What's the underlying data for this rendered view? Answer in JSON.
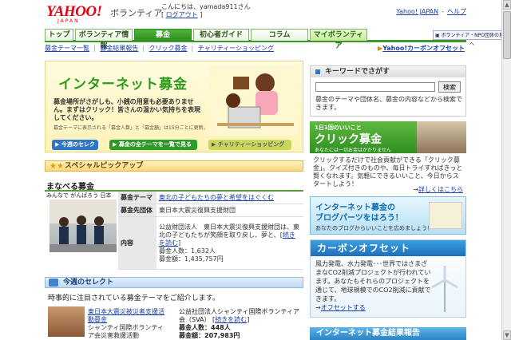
{
  "header": {
    "logo": "YAHOO!",
    "logo_sub": "JAPAN",
    "brand": "ボランティア",
    "greeting": "こんにちは、yamada911さん",
    "logout": "ログアウト",
    "top_links": [
      "Yahoo! JAPAN",
      "ヘルプ"
    ]
  },
  "nav": {
    "tabs": [
      "トップ",
      "ボランティア情報",
      "募金",
      "初心者ガイド",
      "コラム",
      "マイボランティア"
    ],
    "partner": "ボランティア・NPO団体の皆様へ"
  },
  "subnav": {
    "items": [
      "募金テーマ一覧",
      "募金結果報告",
      "クリック募金",
      "チャリティーショッピング"
    ],
    "carbon": "Yahoo!カーボンオフセット"
  },
  "hero": {
    "title": "インターネット募金",
    "desc": "募金場所がさがしも、小銭の用意も必要ありません。まずはクリック！皆さんの温かい気持ちを表現してください。",
    "note": "募金テーマに表示される「募金人数」と「募金額」は15分ごとに更新。",
    "buttons": [
      "今週のセレクト",
      "募金の全テーマを一覧で見る",
      "チャリティーショッピング"
    ]
  },
  "special": {
    "header": "スペシャルピックアップ",
    "title": "まなべる募金",
    "photo_caption": "みんなで がんばろう 日本",
    "rows": [
      {
        "k": "募金テーマ",
        "v": "東北の子どもたちの夢と希望をはぐくむ"
      },
      {
        "k": "募金先団体",
        "v": "東日本大震災復興支援財団"
      },
      {
        "k": "内容",
        "v": "公益財団法人　東日本大震災復興支援財団は、東北の子どもたちが笑顔を取り戻し、夢と、"
      }
    ],
    "more": "続きを読む",
    "people": "募金人数：1,632人",
    "amount": "募金額：1,435,757円"
  },
  "week": {
    "header": "今週のセレクト",
    "desc": "時事的に注目されている募金テーマをご紹介します。",
    "title": "東日本大震災被災者支援活動募金",
    "org": "シャンティ国際ボランティア会災害救援活動",
    "org2": "公益社団法人シャンティ国際ボランティア会（SVA）",
    "more": "続きを読む",
    "people": "募金人数：448人",
    "amount": "募金額：207,983円"
  },
  "keyword": {
    "header": "キーワードでさがす",
    "placeholder": "",
    "button": "検索",
    "desc": "募金のテーマや団体名、募金の内容などから検索できます。"
  },
  "click": {
    "small": "1日1回のいいこと",
    "big": "クリック募金",
    "foot": "あなたには一切お金はかかりません",
    "desc": "クリックするだけで社会貢献ができる「クリック募金」。クイズ付きのものや、毎日トライすればきっと賢くなれます。気軽にできるいいこと、今日からスタートしよう！",
    "more": "詳しくはこちら"
  },
  "parts": {
    "t1": "インターネット募金の",
    "t2": "ブログパーツをはろう！",
    "t3": "あなたのブログからいいことを広めましょう！"
  },
  "carbon": {
    "title": "カーボンオフセット",
    "desc": "風力発電、水力発電･･･世界ではさまざまなCO2削減プロジェクトが行われています。あなたもそれらのプロジェクトを通じて、地球規模でのCO2削減に貢献できます。",
    "link": "オフセットする"
  },
  "report": {
    "title": "インターネット募金結果報告"
  }
}
